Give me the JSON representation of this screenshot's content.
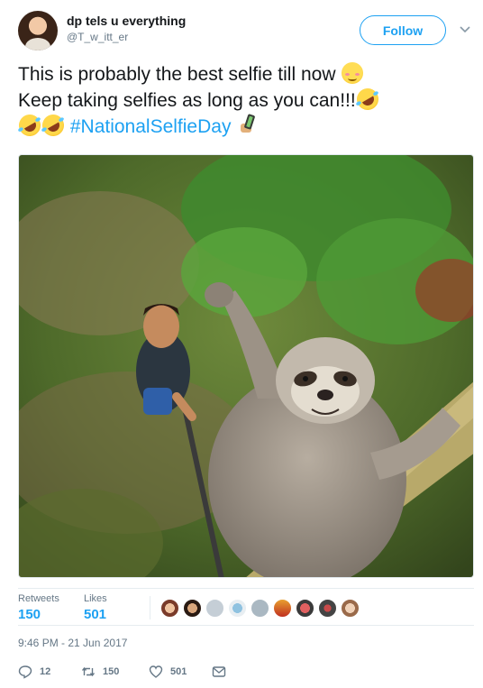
{
  "author": {
    "display_name": "dp tels u everything",
    "handle": "@T_w_itt_er",
    "avatar_icon": "profile-photo"
  },
  "header": {
    "follow_label": "Follow",
    "menu_icon": "chevron-down-icon"
  },
  "tweet": {
    "line1": "This is probably the best selfie till now",
    "line2": "Keep taking selfies as long as you can!!!",
    "hashtag": "#NationalSelfieDay",
    "photo_description_icon": "attached-photo"
  },
  "stats": {
    "retweets_label": "Retweets",
    "retweets_value": "150",
    "likes_label": "Likes",
    "likes_value": "501"
  },
  "timestamp": "9:46 PM - 21 Jun 2017",
  "actions": {
    "reply_count": "12",
    "retweet_count": "150",
    "like_count": "501"
  },
  "colors": {
    "accent": "#1da1f2",
    "muted": "#657786",
    "text": "#14171a",
    "border": "#e6ecf0"
  }
}
